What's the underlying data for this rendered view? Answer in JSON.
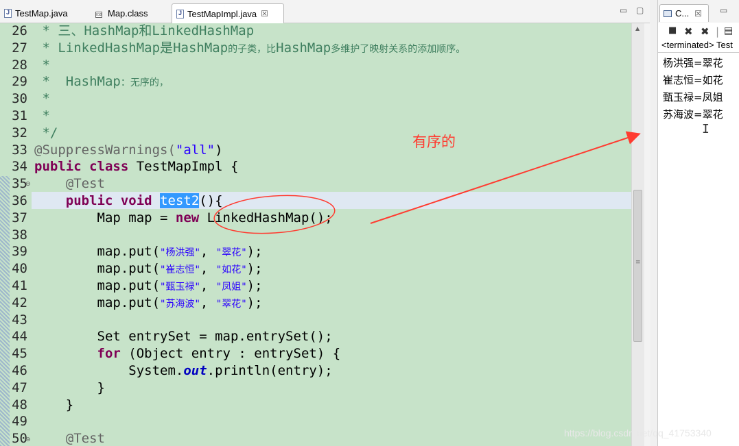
{
  "editor_tabs": [
    {
      "label": "TestMap.java",
      "icon": "java-file-icon"
    },
    {
      "label": "Map.class",
      "icon": "class-file-icon"
    },
    {
      "label": "TestMapImpl.java",
      "icon": "java-file-icon",
      "active": true
    }
  ],
  "editor_tab_close": "☒",
  "window_buttons": {
    "minimize": "▭",
    "maximize": "▢"
  },
  "gutter": {
    "line_numbers": [
      "26",
      "27",
      "28",
      "29",
      "30",
      "31",
      "32",
      "33",
      "34",
      "35",
      "36",
      "37",
      "38",
      "39",
      "40",
      "41",
      "42",
      "43",
      "44",
      "45",
      "46",
      "47",
      "48",
      "49",
      "50"
    ]
  },
  "code": {
    "l26": {
      "t1": " * 三、",
      "t2": "HashMap",
      "t3": "和",
      "t4": "LinkedHashMap"
    },
    "l27": {
      "t1": " * ",
      "t2": "LinkedHashMap",
      "t3": "是",
      "t4": "HashMap",
      "t5": "的子类，比",
      "t6": "HashMap",
      "t7": "多维护了映射关系的添加顺序。"
    },
    "l28": " *",
    "l29": {
      "t1": " *  HashMap",
      "t2": "：无序的，"
    },
    "l30": " *",
    "l31": " *",
    "l32": " */",
    "l33": {
      "ann": "@SuppressWarnings(",
      "str": "\"all\"",
      "end": ")"
    },
    "l34": {
      "kw1": "public",
      "kw2": "class",
      "rest": " TestMapImpl {"
    },
    "l35": "    @Test",
    "l36": {
      "indent": "    ",
      "kw1": "public",
      "kw2": "void",
      "sel": "test2",
      "end": "(){"
    },
    "l37": {
      "pre": "        Map map = ",
      "kw": "new",
      "rest": " LinkedHashMap();"
    },
    "l38": "",
    "puts": [
      {
        "k": "\"杨洪强\"",
        "v": "\"翠花\""
      },
      {
        "k": "\"崔志恒\"",
        "v": "\"如花\""
      },
      {
        "k": "\"甄玉禄\"",
        "v": "\"凤姐\""
      },
      {
        "k": "\"苏海波\"",
        "v": "\"翠花\""
      }
    ],
    "put_prefix": "        map.put(",
    "put_sep": ", ",
    "put_end": ");",
    "l44": "        Set entrySet = map.entrySet();",
    "l45": {
      "kw": "for",
      "rest": " (Object entry : entrySet) {"
    },
    "l46": {
      "pre": "            System.",
      "fld": "out",
      "rest": ".println(entry);"
    },
    "l47": "        }",
    "l48": "    }",
    "l49": "",
    "l50": "    @Test"
  },
  "annotation": {
    "label": "有序的",
    "color": "#ff3b30"
  },
  "console": {
    "tab_label": "C...",
    "tab_close": "☒",
    "status": "<terminated> Test",
    "output": [
      "杨洪强=翠花",
      "崔志恒=如花",
      "甄玉禄=凤姐",
      "苏海波=翠花"
    ]
  },
  "watermark": "https://blog.csdn.net/qq_41753340",
  "colors": {
    "editor_bg": "#c7e3c9",
    "keyword": "#7f0055",
    "string": "#2a00ff",
    "comment": "#3f7f5f",
    "selection": "#3399ff"
  }
}
